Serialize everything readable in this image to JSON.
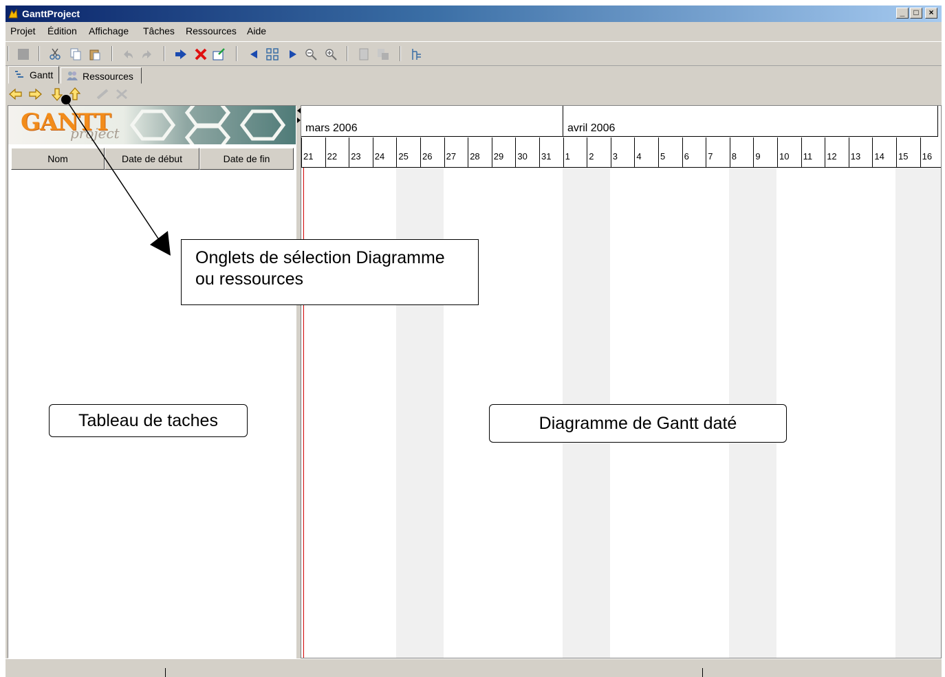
{
  "window": {
    "title": "GanttProject",
    "buttons": [
      "_",
      "□",
      "×"
    ]
  },
  "menu": [
    "Projet",
    "Édition",
    "Affichage",
    "Tâches",
    "Ressources",
    "Aide"
  ],
  "toolbar_icons": [
    "save-icon",
    "cut-icon",
    "copy-icon",
    "paste-icon",
    "undo-icon",
    "redo-icon",
    "indent-task-icon",
    "delete-task-icon",
    "task-properties-icon",
    "scroll-left-icon",
    "zoom-fit-icon",
    "scroll-right-icon",
    "zoom-out-icon",
    "zoom-in-icon",
    "print-icon",
    "print-preview-icon",
    "critical-path-icon"
  ],
  "tabs": {
    "gantt": "Gantt",
    "resources": "Ressources"
  },
  "logo": {
    "main": "GANTT",
    "sub": "project"
  },
  "task_table": {
    "columns": [
      "Nom",
      "Date de début",
      "Date de fin"
    ]
  },
  "chart": {
    "months": [
      "mars 2006",
      "avril 2006"
    ],
    "days": [
      "21",
      "22",
      "23",
      "24",
      "25",
      "26",
      "27",
      "28",
      "29",
      "30",
      "31",
      "1",
      "2",
      "3",
      "4",
      "5",
      "6",
      "7",
      "8",
      "9",
      "10",
      "11",
      "12",
      "13",
      "14",
      "15",
      "16"
    ]
  },
  "annotations": {
    "tabs_callout_line1": "Onglets de sélection Diagramme",
    "tabs_callout_line2": "ou ressources",
    "task_table": "Tableau de taches",
    "gantt_chart": "Diagramme de Gantt daté"
  },
  "colors": {
    "titlebar_start": "#0a246a",
    "titlebar_end": "#a6caf0",
    "chrome": "#d4d0c8",
    "today_line": "#d00000",
    "weekend": "#f0f0f0"
  }
}
